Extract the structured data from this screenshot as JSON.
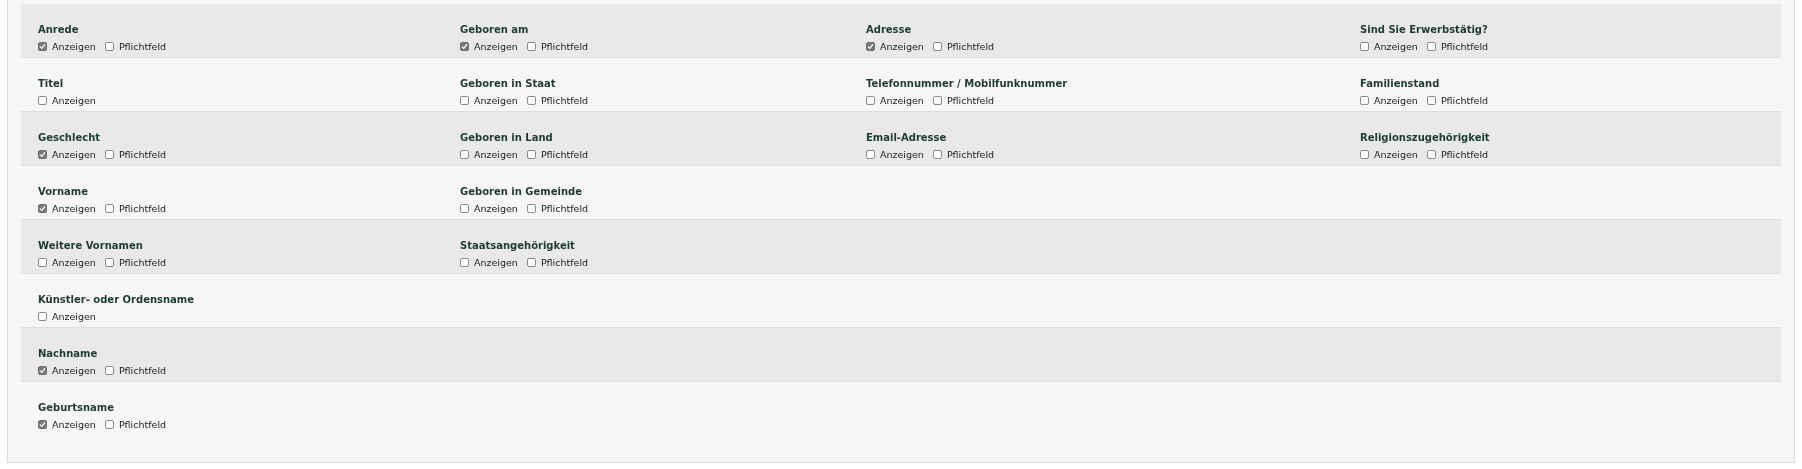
{
  "rows": [
    {
      "fields": [
        {
          "label": "Anrede",
          "options": [
            {
              "label": "Anzeigen",
              "checked": true
            },
            {
              "label": "Pflichtfeld",
              "checked": false
            }
          ]
        },
        {
          "label": "Geboren am",
          "options": [
            {
              "label": "Anzeigen",
              "checked": true
            },
            {
              "label": "Pflichtfeld",
              "checked": false
            }
          ]
        },
        {
          "label": "Adresse",
          "options": [
            {
              "label": "Anzeigen",
              "checked": true
            },
            {
              "label": "Pflichtfeld",
              "checked": false
            }
          ]
        },
        {
          "label": "Sind Sie Erwerbstätig?",
          "options": [
            {
              "label": "Anzeigen",
              "checked": false
            },
            {
              "label": "Pflichtfeld",
              "checked": false
            }
          ]
        }
      ]
    },
    {
      "fields": [
        {
          "label": "Titel",
          "options": [
            {
              "label": "Anzeigen",
              "checked": false
            }
          ]
        },
        {
          "label": "Geboren in Staat",
          "options": [
            {
              "label": "Anzeigen",
              "checked": false
            },
            {
              "label": "Pflichtfeld",
              "checked": false
            }
          ]
        },
        {
          "label": "Telefonnummer / Mobilfunknummer",
          "options": [
            {
              "label": "Anzeigen",
              "checked": false
            },
            {
              "label": "Pflichtfeld",
              "checked": false
            }
          ]
        },
        {
          "label": "Familienstand",
          "options": [
            {
              "label": "Anzeigen",
              "checked": false
            },
            {
              "label": "Pflichtfeld",
              "checked": false
            }
          ]
        }
      ]
    },
    {
      "fields": [
        {
          "label": "Geschlecht",
          "options": [
            {
              "label": "Anzeigen",
              "checked": true
            },
            {
              "label": "Pflichtfeld",
              "checked": false
            }
          ]
        },
        {
          "label": "Geboren in Land",
          "options": [
            {
              "label": "Anzeigen",
              "checked": false
            },
            {
              "label": "Pflichtfeld",
              "checked": false
            }
          ]
        },
        {
          "label": "Email-Adresse",
          "options": [
            {
              "label": "Anzeigen",
              "checked": false
            },
            {
              "label": "Pflichtfeld",
              "checked": false
            }
          ]
        },
        {
          "label": "Religionszugehörigkeit",
          "options": [
            {
              "label": "Anzeigen",
              "checked": false
            },
            {
              "label": "Pflichtfeld",
              "checked": false
            }
          ]
        }
      ]
    },
    {
      "fields": [
        {
          "label": "Vorname",
          "options": [
            {
              "label": "Anzeigen",
              "checked": true
            },
            {
              "label": "Pflichtfeld",
              "checked": false
            }
          ]
        },
        {
          "label": "Geboren in Gemeinde",
          "options": [
            {
              "label": "Anzeigen",
              "checked": false
            },
            {
              "label": "Pflichtfeld",
              "checked": false
            }
          ]
        }
      ]
    },
    {
      "fields": [
        {
          "label": "Weitere Vornamen",
          "options": [
            {
              "label": "Anzeigen",
              "checked": false
            },
            {
              "label": "Pflichtfeld",
              "checked": false
            }
          ]
        },
        {
          "label": "Staatsangehörigkeit",
          "options": [
            {
              "label": "Anzeigen",
              "checked": false
            },
            {
              "label": "Pflichtfeld",
              "checked": false
            }
          ]
        }
      ]
    },
    {
      "fields": [
        {
          "label": "Künstler- oder Ordensname",
          "options": [
            {
              "label": "Anzeigen",
              "checked": false
            }
          ]
        }
      ]
    },
    {
      "fields": [
        {
          "label": "Nachname",
          "options": [
            {
              "label": "Anzeigen",
              "checked": true
            },
            {
              "label": "Pflichtfeld",
              "checked": false
            }
          ]
        }
      ]
    },
    {
      "fields": [
        {
          "label": "Geburtsname",
          "options": [
            {
              "label": "Anzeigen",
              "checked": true
            },
            {
              "label": "Pflichtfeld",
              "checked": false
            }
          ]
        }
      ]
    }
  ]
}
